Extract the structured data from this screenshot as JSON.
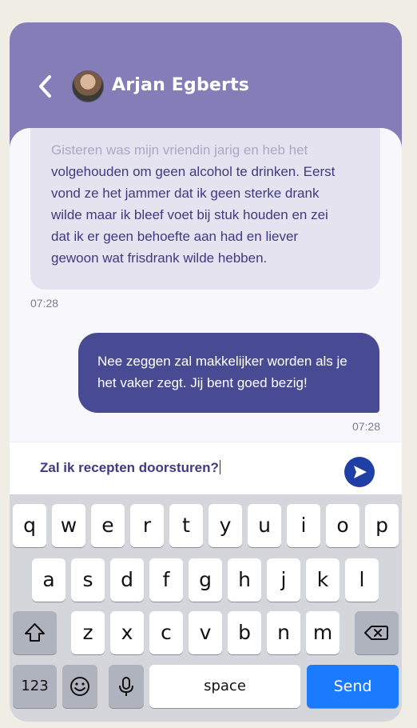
{
  "header": {
    "contact_name": "Arjan Egberts"
  },
  "messages": {
    "incoming": {
      "lines": [
        "Gisteren was mijn vriendin jarig en heb het",
        "volgehouden om geen alcohol te drinken. Eerst",
        "vond ze het jammer dat ik geen sterke drank",
        "wilde maar ik bleef voet bij stuk houden en zei",
        "dat ik er geen behoefte aan had en liever",
        "gewoon wat frisdrank wilde hebben."
      ],
      "time": "07:28"
    },
    "outgoing": {
      "lines": [
        "Nee zeggen zal makkelijker worden als je",
        "het vaker zegt. Jij bent goed bezig!"
      ],
      "time": "07:28"
    }
  },
  "composer": {
    "value": "Zal ik recepten doorsturen?"
  },
  "keyboard": {
    "row1": [
      "q",
      "w",
      "e",
      "r",
      "t",
      "y",
      "u",
      "i",
      "o",
      "p"
    ],
    "row2": [
      "a",
      "s",
      "d",
      "f",
      "g",
      "h",
      "j",
      "k",
      "l"
    ],
    "row3": [
      "z",
      "x",
      "c",
      "v",
      "b",
      "n",
      "m"
    ],
    "numbers_label": "123",
    "space_label": "space",
    "send_label": "Send"
  },
  "colors": {
    "header": "#857db7",
    "incoming_bubble": "#e5e3ef",
    "outgoing_bubble": "#484a93",
    "send_button": "#1f3fa5",
    "keyboard_send": "#1a7bff"
  }
}
